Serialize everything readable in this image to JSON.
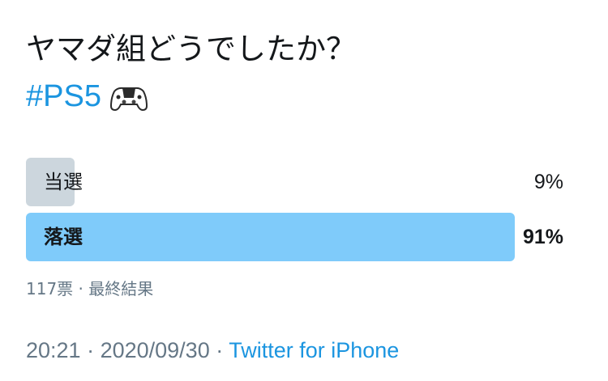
{
  "tweet": {
    "text_line1": "ヤマダ組どうでしたか？",
    "hashtag": "#PS5",
    "emoji": "game-controller"
  },
  "poll": {
    "options": [
      {
        "label": "当選",
        "percent_label": "9%",
        "percent": 9,
        "winner": false
      },
      {
        "label": "落選",
        "percent_label": "91%",
        "percent": 91,
        "winner": true
      }
    ],
    "meta": "117票 · 最終結果"
  },
  "footer": {
    "time": "20:21",
    "separator1": " · ",
    "date": "2020/09/30",
    "separator2": " · ",
    "source": "Twitter for iPhone"
  },
  "colors": {
    "hashtag": "#1b95e0",
    "winner_bar": "#7fcbfa",
    "loser_bar": "#ccd6dd",
    "meta_text": "#657786"
  }
}
